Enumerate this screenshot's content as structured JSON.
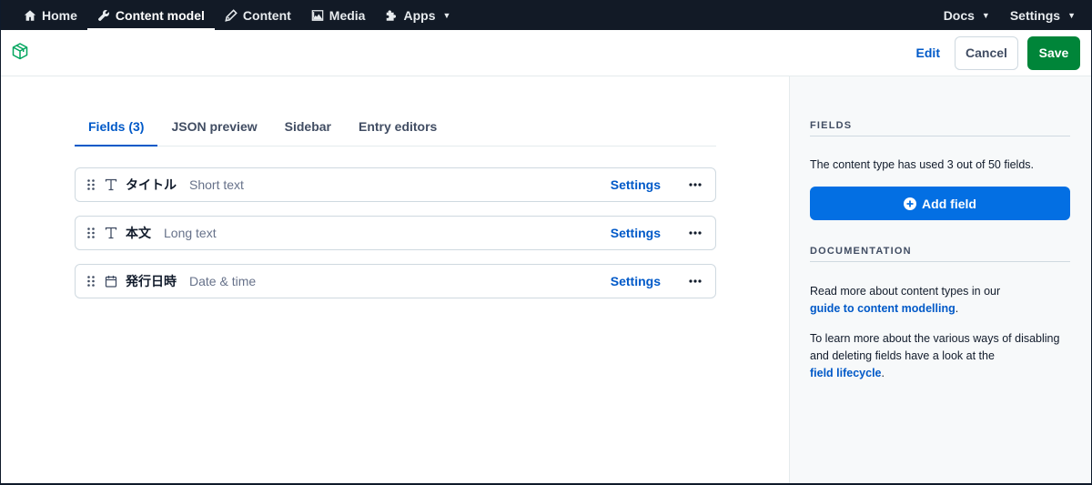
{
  "nav": {
    "left": [
      {
        "label": "Home",
        "icon": "home-icon"
      },
      {
        "label": "Content model",
        "icon": "wrench-icon",
        "active": true
      },
      {
        "label": "Content",
        "icon": "pen-icon"
      },
      {
        "label": "Media",
        "icon": "image-icon"
      },
      {
        "label": "Apps",
        "icon": "puzzle-icon"
      }
    ],
    "right": [
      {
        "label": "Docs"
      },
      {
        "label": "Settings"
      }
    ]
  },
  "toolbar": {
    "logo_icon": "box-icon",
    "edit_label": "Edit",
    "cancel_label": "Cancel",
    "save_label": "Save"
  },
  "tabs": [
    {
      "label": "Fields (3)",
      "active": true
    },
    {
      "label": "JSON preview"
    },
    {
      "label": "Sidebar"
    },
    {
      "label": "Entry editors"
    }
  ],
  "fields": [
    {
      "name": "タイトル",
      "type": "Short text",
      "icon": "text-icon",
      "settings_label": "Settings"
    },
    {
      "name": "本文",
      "type": "Long text",
      "icon": "text-icon",
      "settings_label": "Settings"
    },
    {
      "name": "発行日時",
      "type": "Date & time",
      "icon": "calendar-icon",
      "settings_label": "Settings"
    }
  ],
  "sidebar": {
    "fields_heading": "FIELDS",
    "fields_text": "The content type has used 3 out of 50 fields.",
    "add_field_label": "Add field",
    "doc_heading": "DOCUMENTATION",
    "doc_text1": "Read more about content types in our",
    "doc_link1": "guide to content modelling",
    "doc_text2": "To learn more about the various ways of disabling and deleting fields have a look at the",
    "doc_link2": "field lifecycle",
    "period": "."
  },
  "colors": {
    "nav_bg": "#121a26",
    "primary": "#0059c8",
    "add_button": "#036fe3",
    "save_button": "#008539",
    "logo": "#00a65e"
  }
}
